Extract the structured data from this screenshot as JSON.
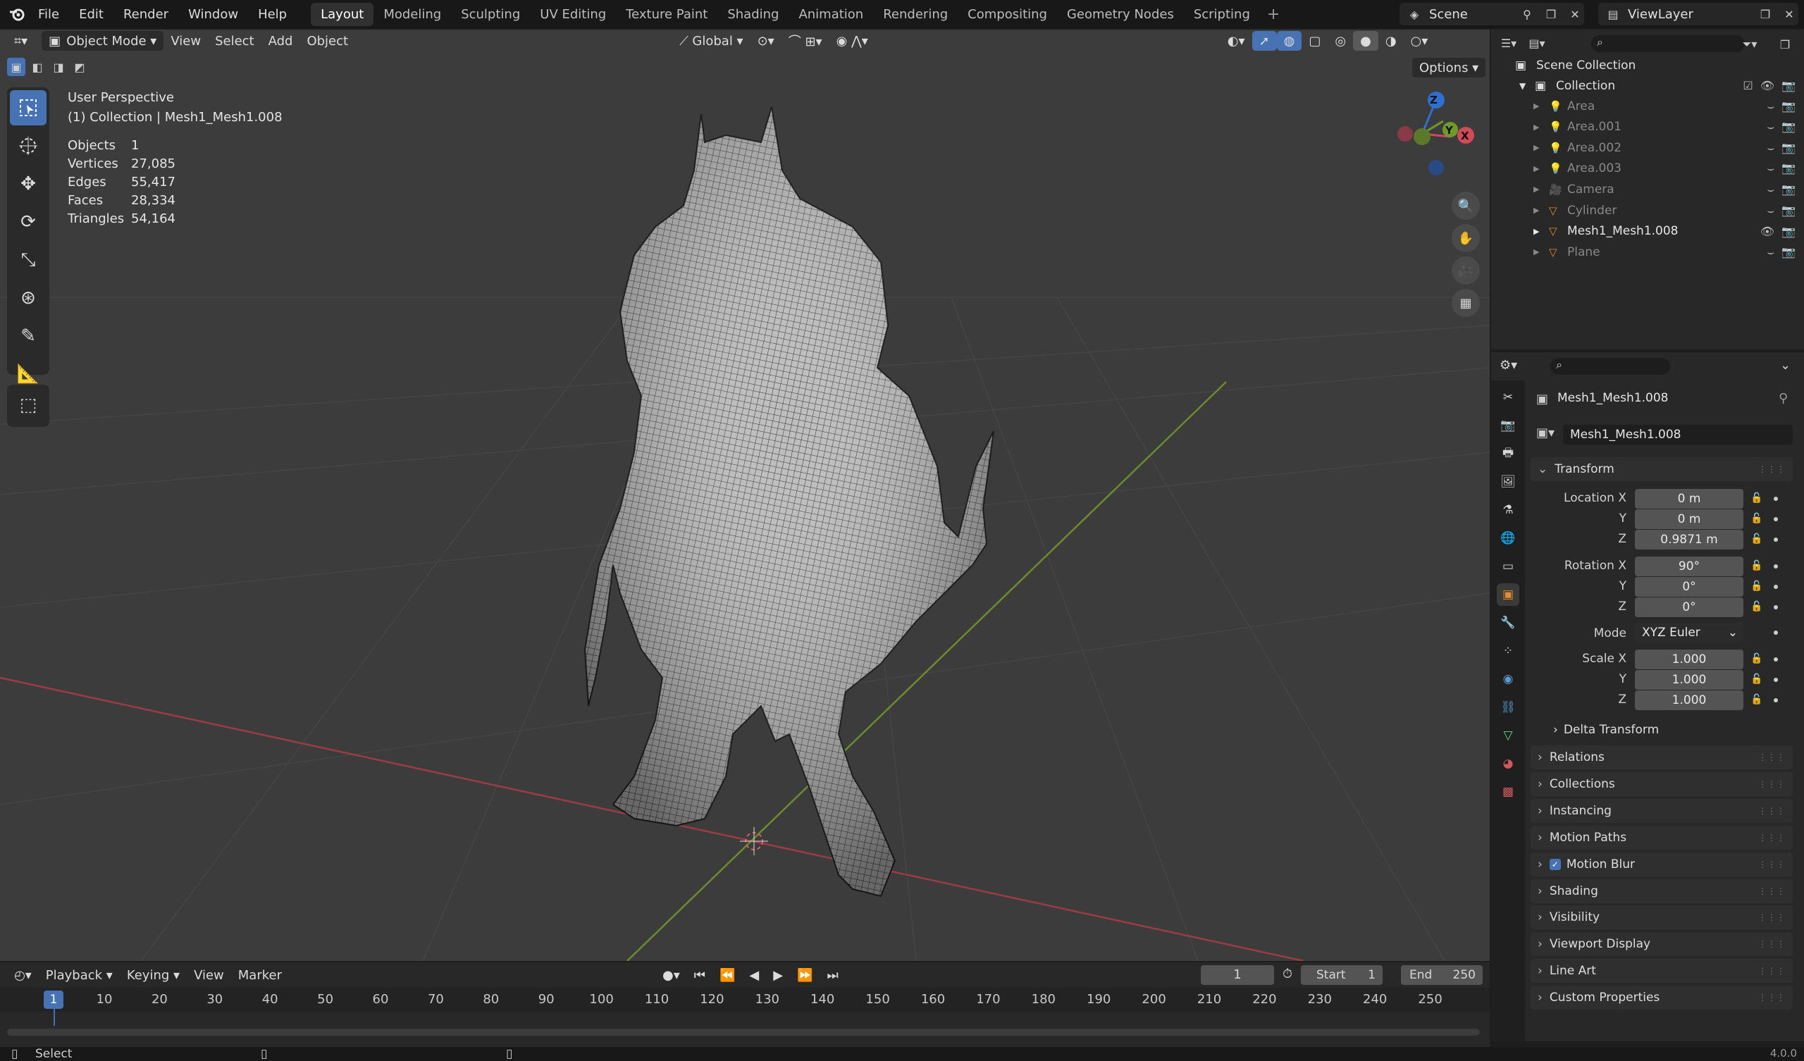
{
  "topbar": {
    "menus": [
      "File",
      "Edit",
      "Render",
      "Window",
      "Help"
    ],
    "workspaces": [
      "Layout",
      "Modeling",
      "Sculpting",
      "UV Editing",
      "Texture Paint",
      "Shading",
      "Animation",
      "Rendering",
      "Compositing",
      "Geometry Nodes",
      "Scripting"
    ],
    "active_workspace": "Layout",
    "scene": "Scene",
    "view_layer": "ViewLayer"
  },
  "viewport": {
    "mode": "Object Mode",
    "menus": [
      "View",
      "Select",
      "Add",
      "Object"
    ],
    "orientation": "Global",
    "options_label": "Options",
    "view_name": "User Perspective",
    "collection_info": "(1) Collection | Mesh1_Mesh1.008",
    "stats": [
      {
        "label": "Objects",
        "value": "1"
      },
      {
        "label": "Vertices",
        "value": "27,085"
      },
      {
        "label": "Edges",
        "value": "55,417"
      },
      {
        "label": "Faces",
        "value": "28,334"
      },
      {
        "label": "Triangles",
        "value": "54,164"
      }
    ],
    "gizmo_axes": [
      "Z",
      "Y",
      "X"
    ],
    "colors": {
      "x_axis": "#d14a5a",
      "y_axis": "#6e9a2a",
      "z_axis": "#2f6fd1",
      "background": "#3c3c3c"
    }
  },
  "outliner": {
    "root": "Scene Collection",
    "collection": "Collection",
    "items": [
      {
        "name": "Area",
        "icon": "light-icon"
      },
      {
        "name": "Area.001",
        "icon": "light-icon"
      },
      {
        "name": "Area.002",
        "icon": "light-icon"
      },
      {
        "name": "Area.003",
        "icon": "light-icon"
      },
      {
        "name": "Camera",
        "icon": "camera-icon"
      },
      {
        "name": "Cylinder",
        "icon": "mesh-icon"
      },
      {
        "name": "Mesh1_Mesh1.008",
        "icon": "mesh-icon",
        "active": true
      },
      {
        "name": "Plane",
        "icon": "mesh-icon"
      }
    ]
  },
  "properties": {
    "object_name": "Mesh1_Mesh1.008",
    "object_field": "Mesh1_Mesh1.008",
    "transform_title": "Transform",
    "location_label": "Location X",
    "rotation_label": "Rotation X",
    "scale_label": "Scale X",
    "y_label": "Y",
    "z_label": "Z",
    "mode_label": "Mode",
    "location": [
      "0 m",
      "0 m",
      "0.9871 m"
    ],
    "rotation": [
      "90°",
      "0°",
      "0°"
    ],
    "rotation_mode": "XYZ Euler",
    "scale": [
      "1.000",
      "1.000",
      "1.000"
    ],
    "delta_transform": "Delta Transform",
    "panels": [
      "Relations",
      "Collections",
      "Instancing",
      "Motion Paths",
      "Motion Blur",
      "Shading",
      "Visibility",
      "Viewport Display",
      "Line Art",
      "Custom Properties"
    ],
    "motion_blur_checked": true
  },
  "timeline": {
    "menus": [
      "Playback",
      "Keying",
      "View",
      "Marker"
    ],
    "current_frame": "1",
    "start_label": "Start",
    "start": "1",
    "end_label": "End",
    "end": "250",
    "ticks": [
      "10",
      "20",
      "30",
      "40",
      "50",
      "60",
      "70",
      "80",
      "90",
      "100",
      "110",
      "120",
      "130",
      "140",
      "150",
      "160",
      "170",
      "180",
      "190",
      "200",
      "210",
      "220",
      "230",
      "240",
      "250"
    ],
    "playhead": "1"
  },
  "statusbar": {
    "left": "Select",
    "version": "4.0.0"
  }
}
